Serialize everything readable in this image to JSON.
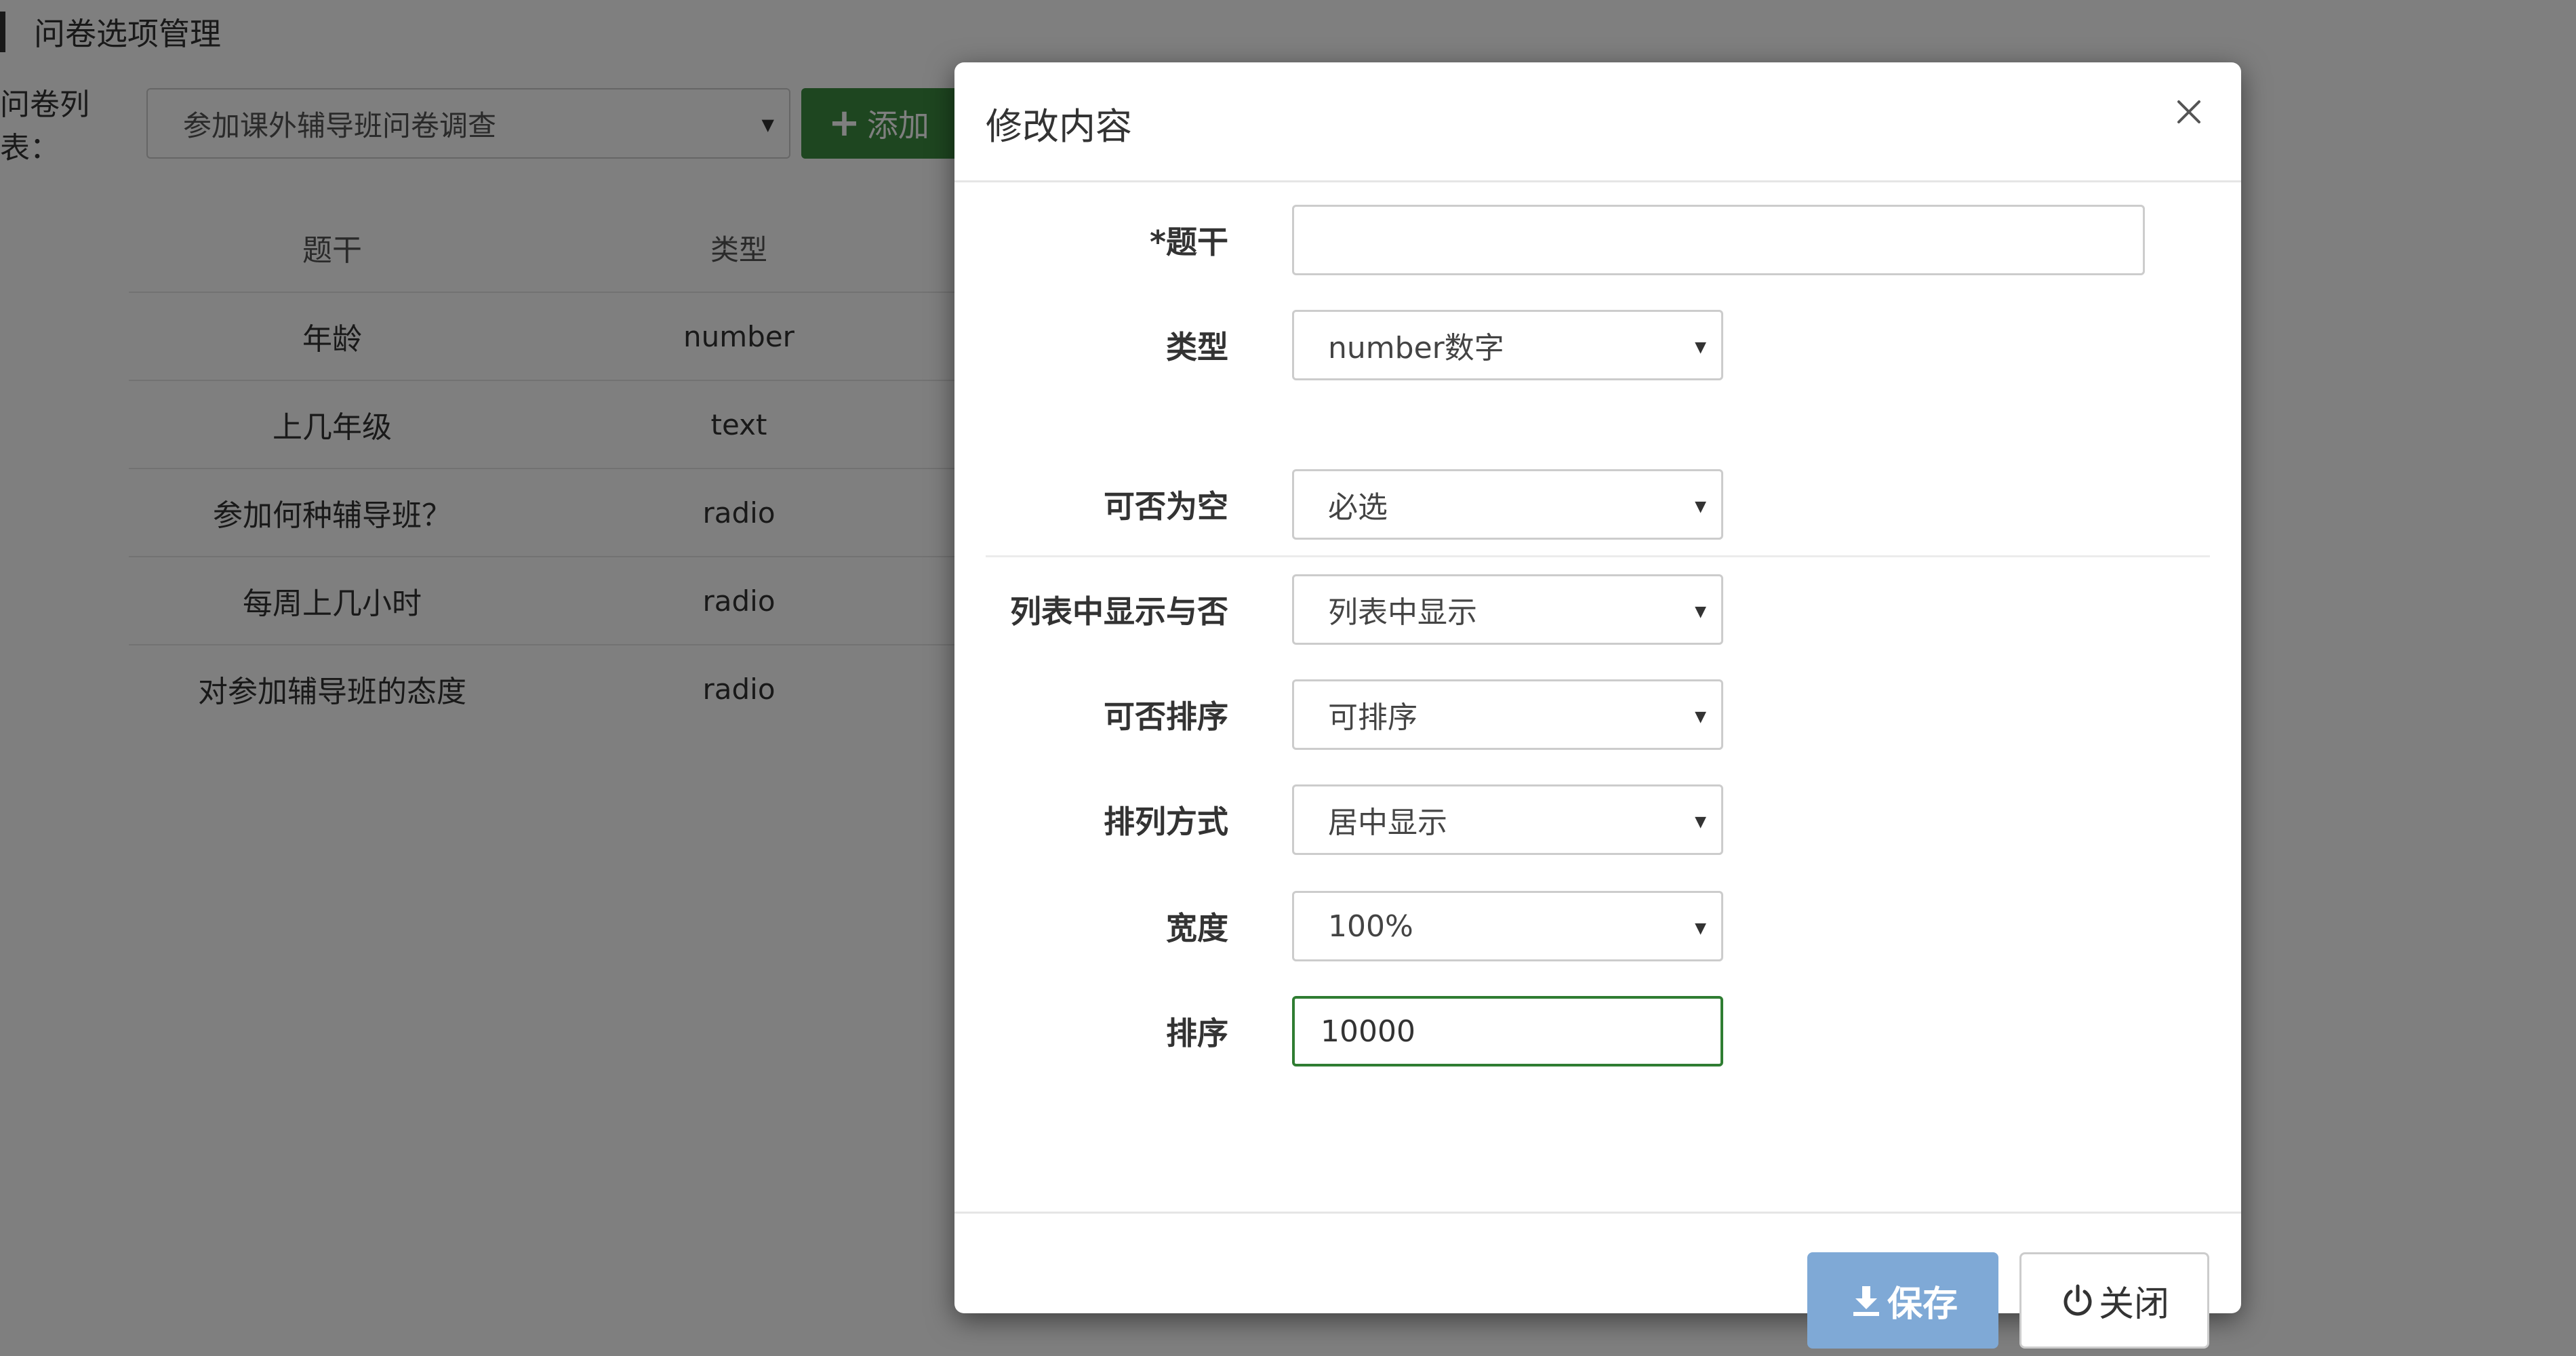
{
  "page": {
    "title": "问卷选项管理",
    "filter_label": "问卷列表：",
    "filter_value": "参加课外辅导班问卷调查",
    "add_label": "添加"
  },
  "table": {
    "headers": [
      "题干",
      "类型"
    ],
    "rows": [
      {
        "question": "年龄",
        "type": "number"
      },
      {
        "question": "上几年级",
        "type": "text"
      },
      {
        "question": "参加何种辅导班？",
        "type": "radio"
      },
      {
        "question": "每周上几小时",
        "type": "radio"
      },
      {
        "question": "对参加辅导班的态度",
        "type": "radio"
      }
    ]
  },
  "modal": {
    "title": "修改内容",
    "fields": {
      "stem": {
        "label": "*题干",
        "value": ""
      },
      "type": {
        "label": "类型",
        "value": "number数字"
      },
      "required": {
        "label": "可否为空",
        "value": "必选"
      },
      "show_in_list": {
        "label": "列表中显示与否",
        "value": "列表中显示"
      },
      "sortable": {
        "label": "可否排序",
        "value": "可排序"
      },
      "align": {
        "label": "排列方式",
        "value": "居中显示"
      },
      "width": {
        "label": "宽度",
        "value": "100%"
      },
      "order": {
        "label": "排序",
        "value": "10000"
      }
    },
    "save_label": "保存",
    "close_label": "关闭"
  },
  "icons": {
    "add": "plus-icon",
    "close": "close-icon",
    "save": "download-icon",
    "power": "power-icon",
    "caret": "caret-down-icon"
  },
  "colors": {
    "add_button": "#3c8d40",
    "save_button": "#7fa9d6",
    "active_border": "#2f7d32"
  }
}
